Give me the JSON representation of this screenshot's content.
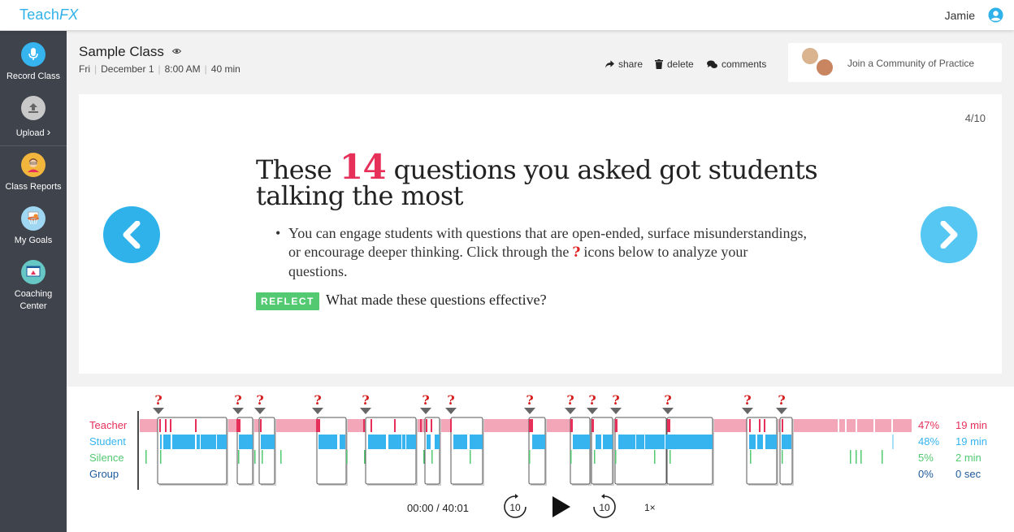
{
  "app": {
    "logo_main": "Teach",
    "logo_accent": "FX"
  },
  "user": {
    "name": "Jamie",
    "icon": "user-circle-icon"
  },
  "colors": {
    "brand": "#2fb2ea",
    "teacher": "#e6305a",
    "teacher_bar": "#f4a6b9",
    "student": "#35b4f0",
    "silence": "#53c971",
    "group": "#1d5a9c",
    "sidebar": "#3f434c"
  },
  "sidebar": {
    "items": [
      {
        "label": "Record Class",
        "icon": "microphone-icon"
      },
      {
        "label": "Upload",
        "icon": "upload-icon",
        "suffix": "›"
      },
      {
        "label": "Class Reports",
        "icon": "teacher-avatar-icon"
      },
      {
        "label": "My Goals",
        "icon": "basketball-hoop-icon"
      },
      {
        "label": "Coaching",
        "label2": "Center",
        "icon": "presentation-board-icon"
      }
    ]
  },
  "header": {
    "title": "Sample Class",
    "day": "Fri",
    "date": "December 1",
    "time": "8:00 AM",
    "duration": "40 min",
    "actions": {
      "share": "share",
      "delete": "delete",
      "comments": "comments"
    },
    "community": "Join a Community of Practice"
  },
  "slide": {
    "counter": "4/10",
    "headline_pre": "These",
    "headline_num": "14",
    "headline_post": "questions you asked got students talking the most",
    "bullet_pre": "You can engage students with questions that are open-ended, surface misunderstandings, or encourage deeper thinking. Click through the",
    "bullet_icon": "?",
    "bullet_post": "icons below to analyze your questions.",
    "reflect_badge": "REFLECT",
    "reflect_question": "What made these questions effective?"
  },
  "timeline": {
    "rows": [
      {
        "label": "Teacher",
        "percent": "47%",
        "time": "19 min"
      },
      {
        "label": "Student",
        "percent": "48%",
        "time": "19 min"
      },
      {
        "label": "Silence",
        "percent": "5%",
        "time": "2 min"
      },
      {
        "label": "Group",
        "percent": "0%",
        "time": "0 sec"
      }
    ],
    "question_marker": "?",
    "question_count": 14
  },
  "player": {
    "current": "00:00",
    "total": "40:01",
    "rewind_label": "10",
    "forward_label": "10",
    "speed": "1×"
  }
}
